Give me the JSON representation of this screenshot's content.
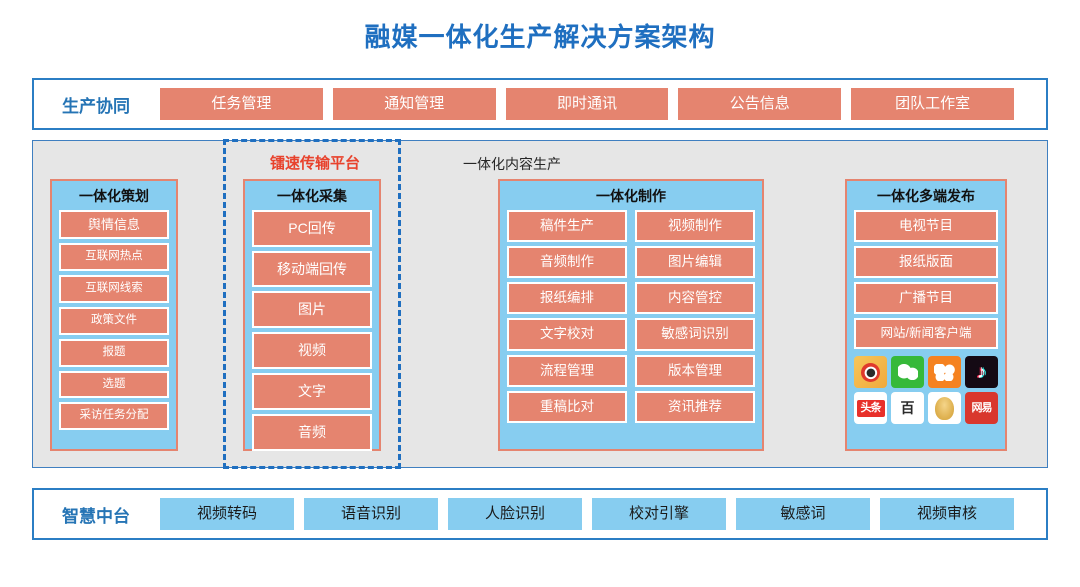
{
  "title": "融媒一体化生产解决方案架构",
  "top_bar": {
    "label": "生产协同",
    "items": [
      "任务管理",
      "通知管理",
      "即时通讯",
      "公告信息",
      "团队工作室"
    ]
  },
  "stage": {
    "captions": {
      "transfer_platform": "镭速传输平台",
      "content_production": "一体化内容生产"
    },
    "panels": {
      "planning": {
        "title": "一体化策划",
        "items": [
          "舆情信息",
          "互联网热点",
          "互联网线索",
          "政策文件",
          "报题",
          "选题",
          "采访任务分配"
        ]
      },
      "capture": {
        "title": "一体化采集",
        "items": [
          "PC回传",
          "移动端回传",
          "图片",
          "视频",
          "文字",
          "音频"
        ]
      },
      "make": {
        "title": "一体化制作",
        "items": [
          "稿件生产",
          "视频制作",
          "音频制作",
          "图片编辑",
          "报纸编排",
          "内容管控",
          "文字校对",
          "敏感词识别",
          "流程管理",
          "版本管理",
          "重稿比对",
          "资讯推荐"
        ]
      },
      "publish": {
        "title": "一体化多端发布",
        "items": [
          "电视节目",
          "报纸版面",
          "广播节目",
          "网站/新闻客户端"
        ],
        "social": [
          {
            "name": "weibo-icon",
            "label": ""
          },
          {
            "name": "wechat-icon",
            "label": ""
          },
          {
            "name": "qzone-icon",
            "label": ""
          },
          {
            "name": "douyin-icon",
            "label": "♪"
          },
          {
            "name": "toutiao-icon",
            "label": "头条"
          },
          {
            "name": "baidu-icon",
            "label": "百"
          },
          {
            "name": "qq-icon",
            "label": ""
          },
          {
            "name": "netease-icon",
            "label": "网易"
          }
        ]
      }
    }
  },
  "bottom_bar": {
    "label": "智慧中台",
    "items": [
      "视频转码",
      "语音识别",
      "人脸识别",
      "校对引擎",
      "敏感词",
      "视频审核"
    ]
  },
  "colors": {
    "title_blue": "#1f6fc0",
    "accent_salmon": "#e5846f",
    "panel_blue": "#87cdf0",
    "border_blue": "#2b7ec4",
    "stage_gray": "#e6e6e6",
    "highlight_red": "#e8422c"
  }
}
